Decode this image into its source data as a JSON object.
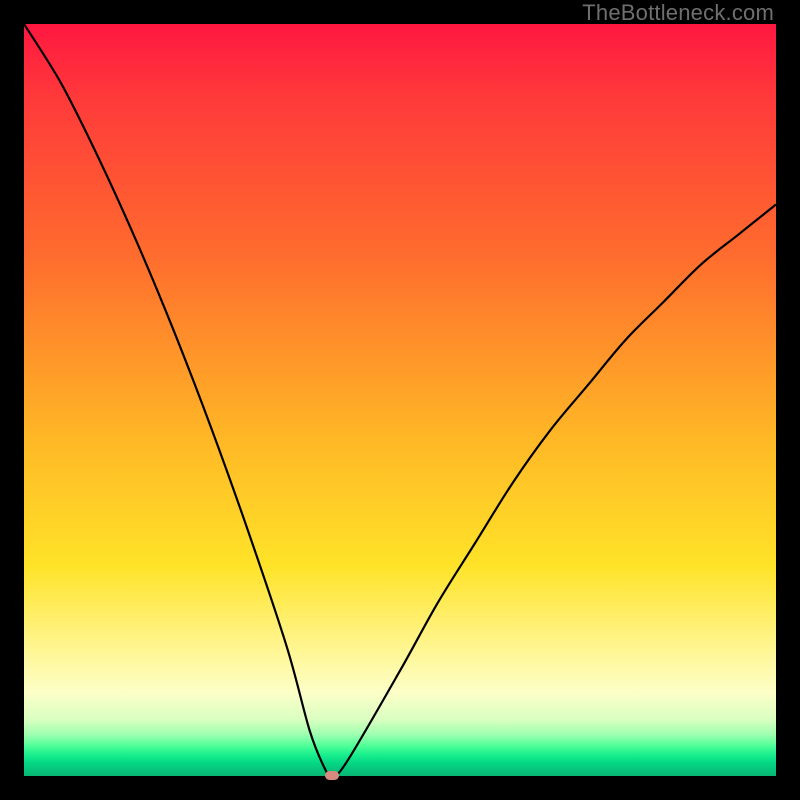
{
  "watermark": "TheBottleneck.com",
  "chart_data": {
    "type": "line",
    "title": "",
    "xlabel": "",
    "ylabel": "",
    "xlim": [
      0,
      100
    ],
    "ylim": [
      0,
      100
    ],
    "grid": false,
    "series": [
      {
        "name": "bottleneck-curve",
        "x": [
          0,
          5,
          10,
          15,
          20,
          25,
          30,
          35,
          38,
          40,
          41,
          43,
          50,
          55,
          60,
          65,
          70,
          75,
          80,
          85,
          90,
          95,
          100
        ],
        "values": [
          100,
          92,
          82,
          71,
          59,
          46,
          32,
          17,
          6,
          1,
          0,
          2,
          14,
          23,
          31,
          39,
          46,
          52,
          58,
          63,
          68,
          72,
          76
        ]
      }
    ],
    "minimum_marker": {
      "x": 41,
      "y": 0
    },
    "background_gradient": {
      "direction": "top-to-bottom",
      "stops": [
        {
          "pos": 0.0,
          "color": "#ff1740"
        },
        {
          "pos": 0.55,
          "color": "#ffb726"
        },
        {
          "pos": 0.84,
          "color": "#fff79a"
        },
        {
          "pos": 0.97,
          "color": "#18ee8d"
        },
        {
          "pos": 1.0,
          "color": "#08b674"
        }
      ]
    }
  }
}
